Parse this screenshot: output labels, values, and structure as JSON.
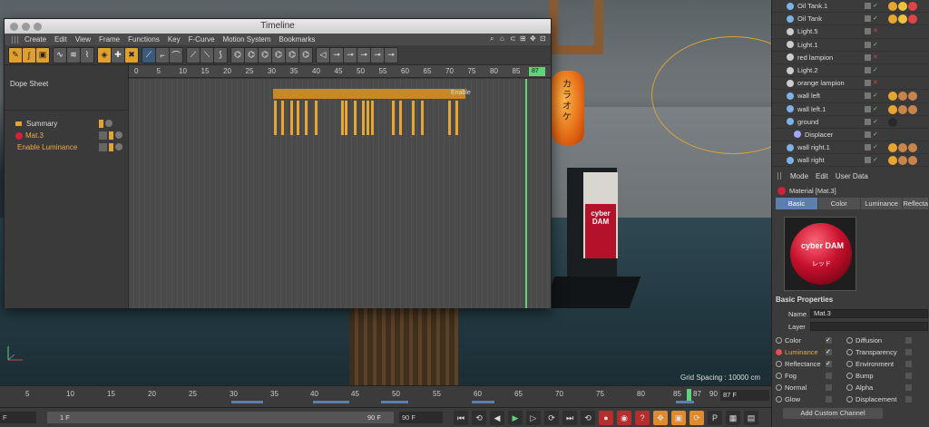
{
  "timeline_window": {
    "title": "Timeline",
    "menu": [
      "Create",
      "Edit",
      "View",
      "Frame",
      "Functions",
      "Key",
      "F-Curve",
      "Motion System",
      "Bookmarks"
    ],
    "mode_label": "Dope Sheet",
    "ruler_ticks": [
      "0",
      "5",
      "10",
      "15",
      "20",
      "25",
      "30",
      "35",
      "40",
      "45",
      "50",
      "55",
      "60",
      "65",
      "70",
      "75",
      "80",
      "85"
    ],
    "current_frame": "87",
    "summary_end_label": "Enable",
    "tracks": [
      {
        "label": "Summary"
      },
      {
        "label": "Mat.3"
      },
      {
        "label": "Enable Luminance"
      }
    ]
  },
  "viewport": {
    "grid_spacing": "Grid Spacing : 10000 cm",
    "lantern_text": "カラオケ",
    "machine_screen": "cyber DAM"
  },
  "objects": {
    "items": [
      {
        "name": "Oil Tank.1",
        "type": "object"
      },
      {
        "name": "Oil Tank",
        "type": "object"
      },
      {
        "name": "Light.5",
        "type": "light"
      },
      {
        "name": "Light.1",
        "type": "light"
      },
      {
        "name": "red lampion",
        "type": "light"
      },
      {
        "name": "Light.2",
        "type": "light"
      },
      {
        "name": "orange lampion",
        "type": "light"
      },
      {
        "name": "wall left",
        "type": "object"
      },
      {
        "name": "wall left.1",
        "type": "object"
      },
      {
        "name": "ground",
        "type": "object"
      },
      {
        "name": "Displacer",
        "type": "deformer"
      },
      {
        "name": "wall right.1",
        "type": "object"
      },
      {
        "name": "wall right",
        "type": "object"
      }
    ]
  },
  "attributes": {
    "menu": [
      "Mode",
      "Edit",
      "User Data"
    ],
    "title": "Material [Mat.3]",
    "tabs": [
      "Basic",
      "Color",
      "Luminance",
      "Reflectance"
    ],
    "active_tab": "Basic",
    "section": "Basic Properties",
    "name_label": "Name",
    "name_value": "Mat.3",
    "layer_label": "Layer",
    "channels_left": [
      {
        "label": "Color",
        "checked": true
      },
      {
        "label": "Luminance",
        "checked": true
      },
      {
        "label": "Reflectance",
        "checked": true
      },
      {
        "label": "Fog",
        "checked": false
      },
      {
        "label": "Normal",
        "checked": false
      },
      {
        "label": "Glow",
        "checked": false
      }
    ],
    "channels_right": [
      {
        "label": "Diffusion",
        "checked": false
      },
      {
        "label": "Transparency",
        "checked": false
      },
      {
        "label": "Environment",
        "checked": false
      },
      {
        "label": "Bump",
        "checked": false
      },
      {
        "label": "Alpha",
        "checked": false
      },
      {
        "label": "Displacement",
        "checked": false
      }
    ],
    "add_channel": "Add Custom Channel",
    "preview_text": "cyber DAM",
    "preview_subtext": "レッド"
  },
  "main_timeline": {
    "ticks": [
      "5",
      "10",
      "15",
      "20",
      "25",
      "30",
      "35",
      "40",
      "45",
      "50",
      "55",
      "60",
      "65",
      "70",
      "75",
      "80",
      "85",
      "87",
      "90"
    ],
    "frame_field": "87 F"
  },
  "transport": {
    "start_field": "F",
    "range_start": "1 F",
    "range_end": "90 F",
    "end_field": "90 F"
  },
  "colors": {
    "keyframe": "#e8a630",
    "playhead": "#5ed37a",
    "active_tab": "#5d7fae"
  }
}
